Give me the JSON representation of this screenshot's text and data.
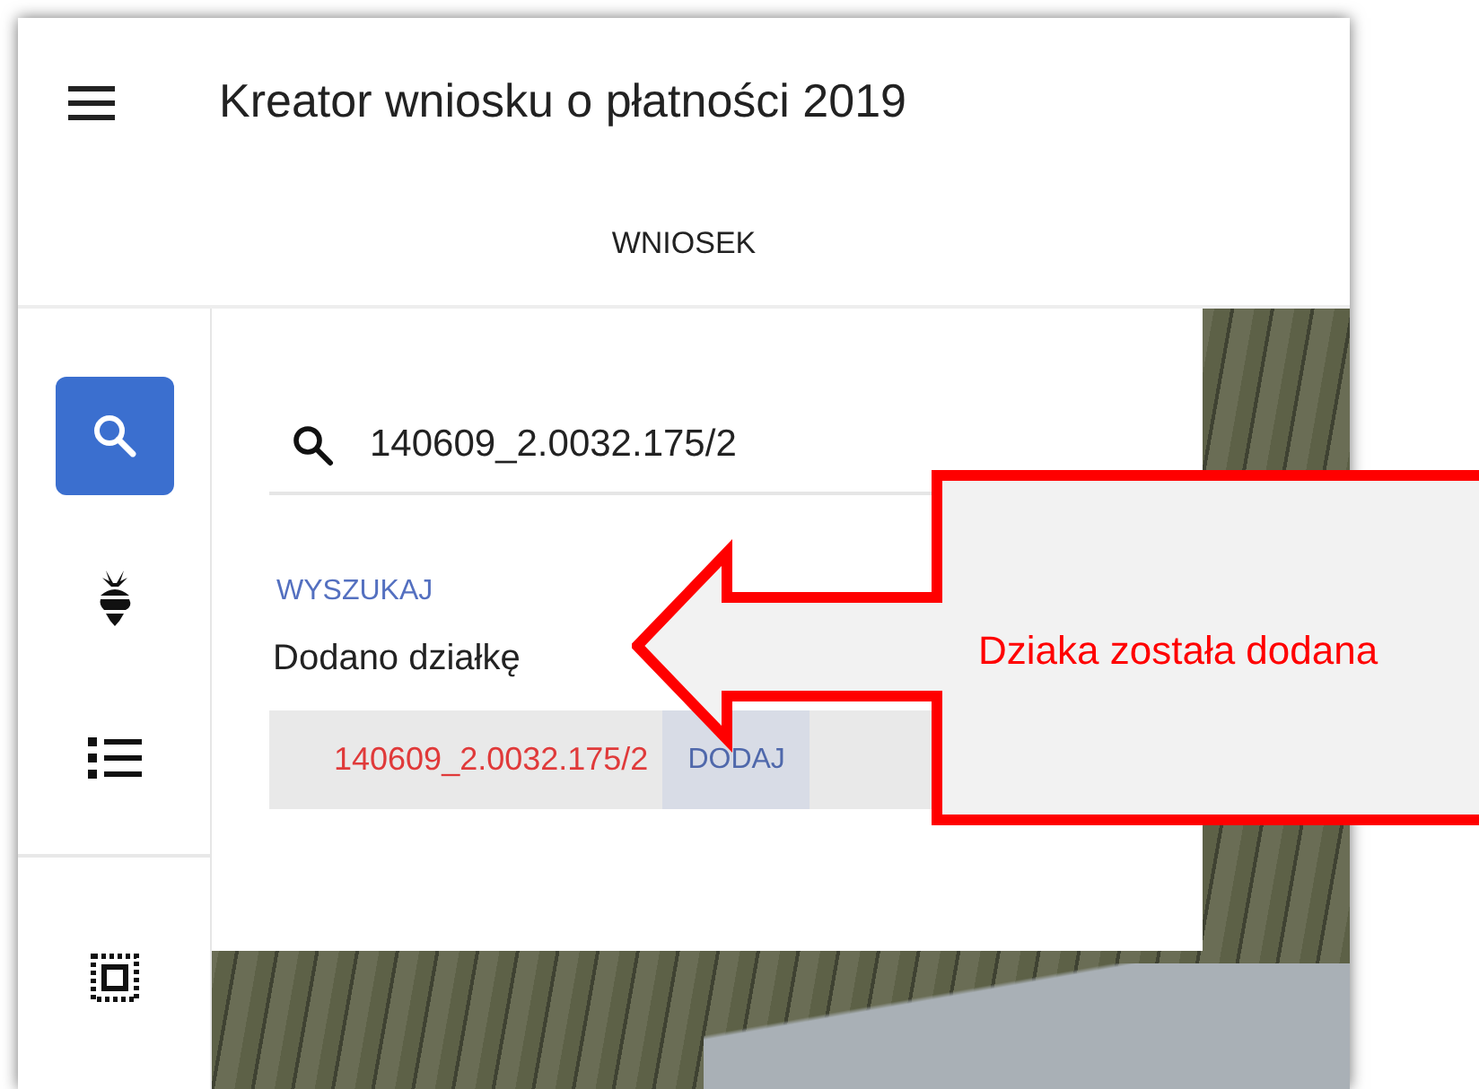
{
  "header": {
    "title": "Kreator wniosku o płatności 2019"
  },
  "tabs": [
    {
      "label": "WNIOSEK"
    }
  ],
  "rail": [
    {
      "kind": "search",
      "selected": true
    },
    {
      "kind": "crop",
      "selected": false
    },
    {
      "kind": "list",
      "selected": false
    },
    {
      "kind": "select",
      "selected": false
    }
  ],
  "search": {
    "value": "140609_2.0032.175/2"
  },
  "search_link": "WYSZUKAJ",
  "message": "Dodano działkę",
  "result": {
    "parcel": "140609_2.0032.175/2",
    "action": "DODAJ"
  },
  "annotation": {
    "text": "Dziaka została dodana"
  }
}
